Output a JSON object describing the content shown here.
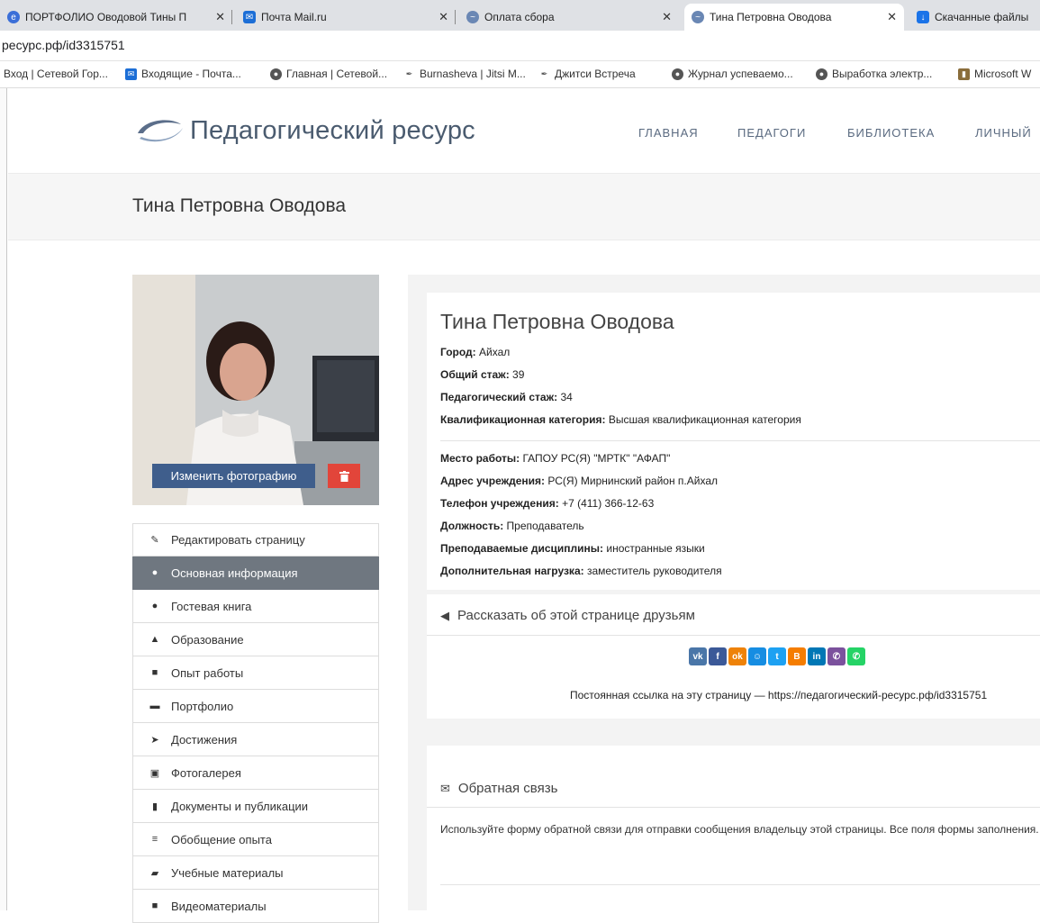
{
  "browser": {
    "tabs": [
      {
        "title": "ПОРТФОЛИО Оводовой Тины П",
        "close": "✕",
        "color": "#3b6fd8"
      },
      {
        "title": "Почта Mail.ru",
        "close": "✕",
        "color": "#1c6ed6"
      },
      {
        "title": "Оплата сбора",
        "close": "✕",
        "color": "#6a87b4"
      },
      {
        "title": "Тина Петровна Оводова",
        "close": "✕",
        "color": "#6a87b4"
      },
      {
        "title": "Скачанные файлы",
        "close": "",
        "color": "#1a73e8"
      }
    ],
    "url": "ресурс.рф/id3315751",
    "bookmarks": [
      "Вход | Сетевой Гор...",
      "Входящие - Почта...",
      "Главная | Сетевой...",
      "Burnasheva | Jitsi M...",
      "Джитси Встреча",
      "Журнал успеваемо...",
      "Выработка электр...",
      "Microsoft W"
    ]
  },
  "site": {
    "logo_text": "Педагогический ресурс",
    "nav": [
      "ГЛАВНАЯ",
      "ПЕДАГОГИ",
      "БИБЛИОТЕКА",
      "ЛИЧНЫЙ"
    ],
    "page_title": "Тина Петровна Оводова"
  },
  "profile": {
    "change_photo_label": "Изменить фотографию",
    "name": "Тина Петровна Оводова",
    "fields": [
      {
        "label": "Город:",
        "value": "Айхал"
      },
      {
        "label": "Общий стаж:",
        "value": "39"
      },
      {
        "label": "Педагогический стаж:",
        "value": "34"
      },
      {
        "label": "Квалификационная категория:",
        "value": "Высшая квалификационная категория"
      }
    ],
    "work_fields": [
      {
        "label": "Место работы:",
        "value": "ГАПОУ РС(Я) \"МРТК\" \"АФАП\""
      },
      {
        "label": "Адрес учреждения:",
        "value": "РС(Я) Мирнинский район п.Айхал"
      },
      {
        "label": "Телефон учреждения:",
        "value": "+7 (411) 366-12-63"
      },
      {
        "label": "Должность:",
        "value": "Преподаватель"
      },
      {
        "label": "Преподаваемые дисциплины:",
        "value": "иностранные языки"
      },
      {
        "label": "Дополнительная нагрузка:",
        "value": "заместитель руководителя"
      }
    ]
  },
  "menu": [
    {
      "label": "Редактировать страницу",
      "icon": "✎",
      "name": "pencil-icon"
    },
    {
      "label": "Основная информация",
      "icon": "●",
      "name": "user-icon",
      "active": true
    },
    {
      "label": "Гостевая книга",
      "icon": "●",
      "name": "comments-icon"
    },
    {
      "label": "Образование",
      "icon": "▲",
      "name": "graduation-cap-icon"
    },
    {
      "label": "Опыт работы",
      "icon": "■",
      "name": "briefcase-icon"
    },
    {
      "label": "Портфолио",
      "icon": "▬",
      "name": "folder-open-icon"
    },
    {
      "label": "Достижения",
      "icon": "➤",
      "name": "rocket-icon"
    },
    {
      "label": "Фотогалерея",
      "icon": "▣",
      "name": "picture-icon"
    },
    {
      "label": "Документы и публикации",
      "icon": "▮",
      "name": "document-icon"
    },
    {
      "label": "Обобщение опыта",
      "icon": "≡",
      "name": "database-icon"
    },
    {
      "label": "Учебные материалы",
      "icon": "▰",
      "name": "book-icon"
    },
    {
      "label": "Видеоматериалы",
      "icon": "■",
      "name": "video-camera-icon"
    }
  ],
  "share": {
    "title": "Рассказать об этой странице друзьям",
    "networks": [
      {
        "label": "vk",
        "color": "#4a76a8"
      },
      {
        "label": "f",
        "color": "#3b5998"
      },
      {
        "label": "ok",
        "color": "#ee8208"
      },
      {
        "label": "☺",
        "color": "#168de2"
      },
      {
        "label": "t",
        "color": "#1da1f2"
      },
      {
        "label": "B",
        "color": "#f57d00"
      },
      {
        "label": "in",
        "color": "#0077b5"
      },
      {
        "label": "✆",
        "color": "#7b519d"
      },
      {
        "label": "✆",
        "color": "#25d366"
      }
    ],
    "permalink": "Постоянная ссылка на эту страницу — https://педагогический-ресурс.рф/id3315751"
  },
  "feedback": {
    "title": "Обратная связь",
    "text": "Используйте форму обратной связи для отправки сообщения владельцу этой страницы. Все поля формы заполнения."
  }
}
